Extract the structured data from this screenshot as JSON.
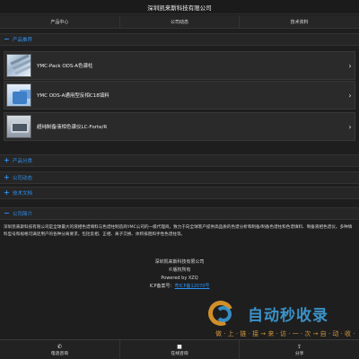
{
  "header": {
    "title": "深圳凯来斯科技有限公司"
  },
  "nav": [
    {
      "label": "产品中心"
    },
    {
      "label": "公司动态"
    },
    {
      "label": "技术资料"
    }
  ],
  "sections": {
    "products_recommended": {
      "icon": "−",
      "title": "产品推荐"
    },
    "product_category": {
      "icon": "+",
      "title": "产品分类"
    },
    "company_news": {
      "icon": "+",
      "title": "公司动态"
    },
    "tech_docs": {
      "icon": "+",
      "title": "技术文档"
    },
    "company_intro": {
      "icon": "−",
      "title": "公司简介"
    }
  },
  "products": [
    {
      "name": "YMC-Pack ODS-A色谱柱",
      "icon": "chevron-right-icon"
    },
    {
      "name": "YMC ODS-A通用型反相C18填料",
      "icon": "chevron-right-icon"
    },
    {
      "name": "超纯制备液相色谱仪LC-Forte/R",
      "icon": "chevron-right-icon"
    }
  ],
  "about": {
    "text": "深圳凯来斯科技有限公司是全球最大的液相色谱填料与色谱柱制造商YMC公司的一级代理商，致力于向全球客户提供高品质的色谱分析和制备/制备色谱柱和色谱填料、制备液相色谱仪。多种填料型号和规格可满足用户的各种分离要求，包括反相、正相、离子交换、体积排阻和手性色谱柱等。"
  },
  "footer": {
    "company": "深圳凯来斯科技有限公司",
    "copyright": "©版权所有",
    "powered": "Powered by XZQ",
    "icp_label": "ICP备案号：",
    "icp_number": "粤ICP备12070号"
  },
  "watermark": {
    "title": "自动秒收录",
    "subtitle": "做 · 上 · 链 · 接 → 来 · 访 · 一 · 次 → 自 · 动 · 收 · 录"
  },
  "bottom_bar": [
    {
      "icon": "phone-icon",
      "glyph": "✆",
      "label": "电话咨询"
    },
    {
      "icon": "online-chat-icon",
      "glyph": "■",
      "label": "在线咨询"
    },
    {
      "icon": "share-icon",
      "glyph": "⇪",
      "label": "分享"
    }
  ],
  "colors": {
    "accent": "#2c92f3",
    "background": "#1e1e1e"
  }
}
